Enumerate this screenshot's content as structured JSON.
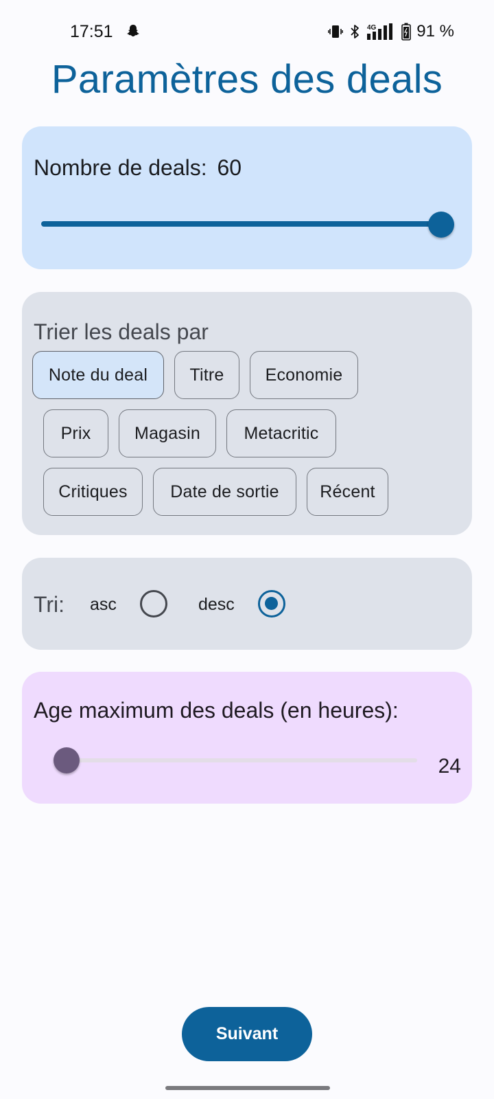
{
  "status_bar": {
    "time": "17:51",
    "network": "4G",
    "battery": "91 %",
    "icons": [
      "snapchat-icon",
      "vibrate-icon",
      "bluetooth-icon",
      "signal-icon",
      "battery-icon"
    ]
  },
  "title": "Paramètres des deals",
  "deal_count": {
    "label": "Nombre de deals:",
    "value": "60",
    "slider_fraction": 1.0
  },
  "sort": {
    "label": "Trier les deals par",
    "options": [
      "Note du deal",
      "Titre",
      "Economie",
      "Prix",
      "Magasin",
      "Metacritic",
      "Critiques",
      "Date de sortie",
      "Récent"
    ],
    "selected": "Note du deal"
  },
  "order": {
    "label": "Tri:",
    "asc_label": "asc",
    "desc_label": "desc",
    "selected": "desc"
  },
  "max_age": {
    "label": "Age maximum des deals (en heures):",
    "value": "24",
    "slider_fraction": 0.0
  },
  "next_button": "Suivant",
  "colors": {
    "primary": "#0d629a",
    "count_card": "#d0e4fc",
    "sort_card": "#dee2ea",
    "age_card": "#efdbfe",
    "age_thumb": "#6b5a7e"
  }
}
